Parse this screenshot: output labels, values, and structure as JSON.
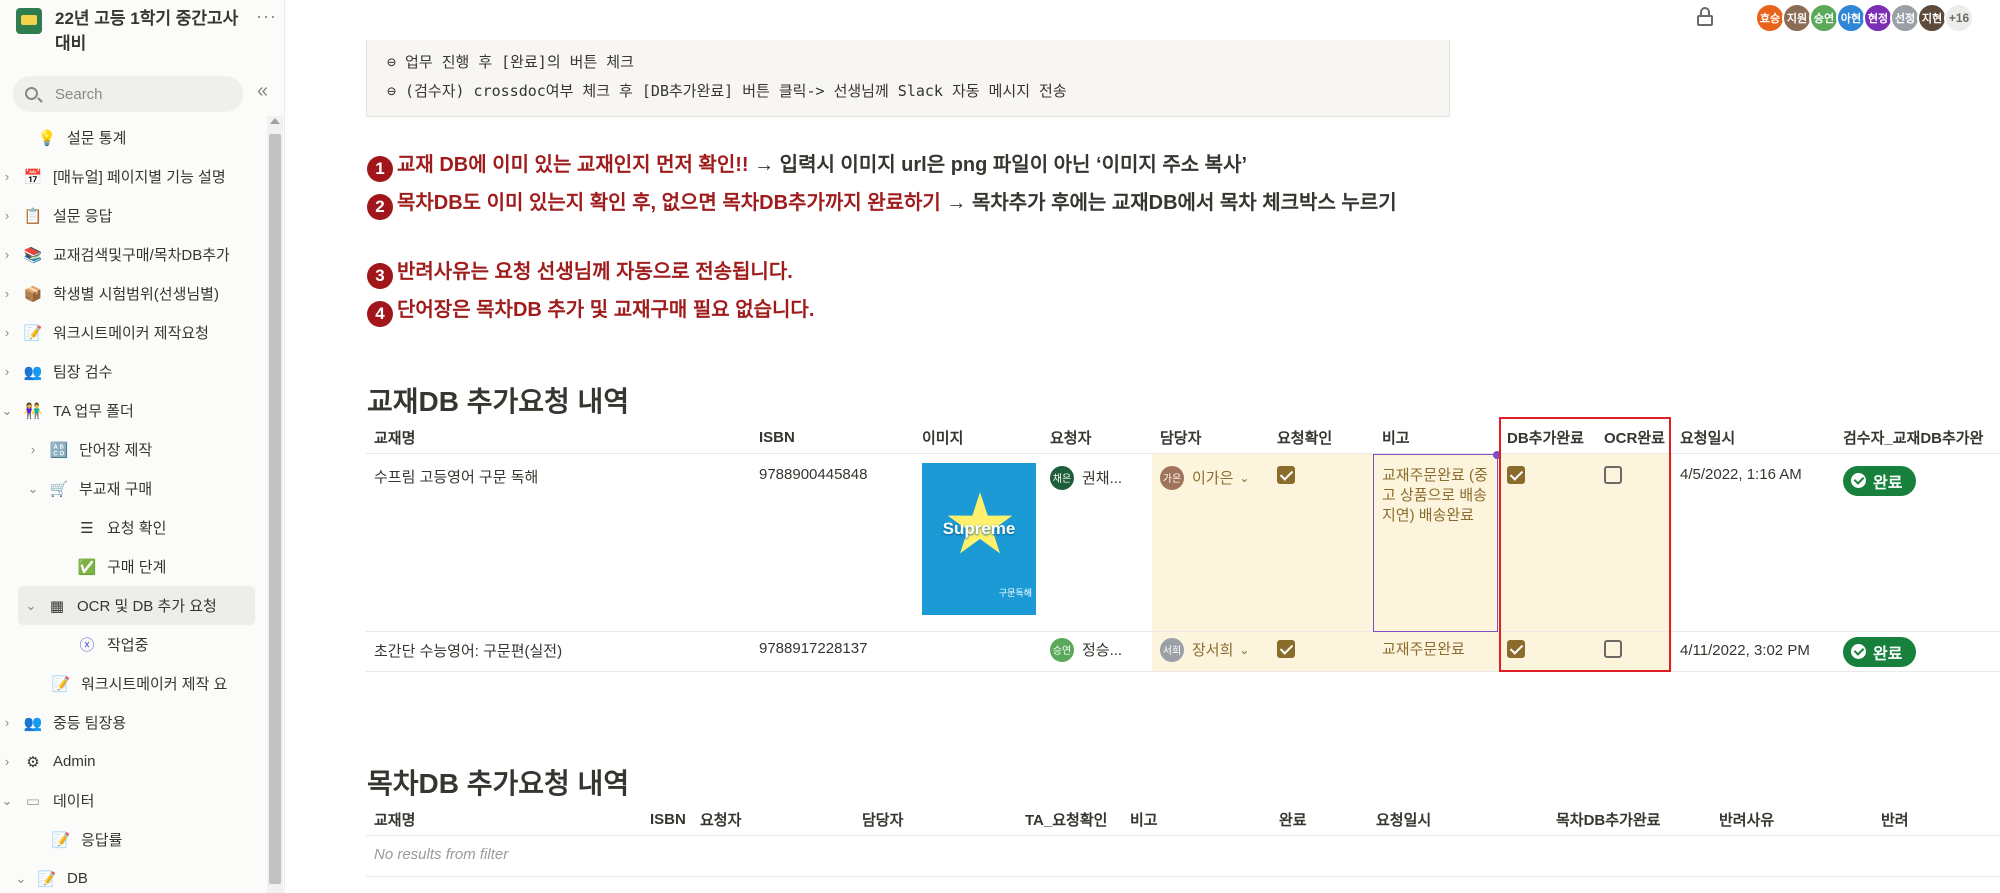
{
  "workspace": {
    "title": "22년 고등 1학기 중간고사 대비",
    "more": "···"
  },
  "search": {
    "placeholder": "Search"
  },
  "sidebar": {
    "collapse": "«",
    "items": [
      {
        "label": "설문 통계",
        "icon": "💡",
        "chev": ""
      },
      {
        "label": "[매뉴얼] 페이지별 기능 설명",
        "icon": "📅",
        "chev": "›"
      },
      {
        "label": "설문 응답",
        "icon": "📋",
        "chev": "›"
      },
      {
        "label": "교재검색및구매/목차DB추가",
        "icon": "📚",
        "chev": "›"
      },
      {
        "label": "학생별 시험범위(선생님별)",
        "icon": "📦",
        "chev": "›"
      },
      {
        "label": "워크시트메이커 제작요청",
        "icon": "📝",
        "chev": "›"
      },
      {
        "label": "팀장 검수",
        "icon": "👥",
        "chev": "›"
      },
      {
        "label": "TA 업무 폴더",
        "icon": "👫",
        "chev": "⌄"
      },
      {
        "label": "단어장 제작",
        "icon": "🔠",
        "chev": "›"
      },
      {
        "label": "부교재 구매",
        "icon": "🛒",
        "chev": "⌄"
      },
      {
        "label": "요청 확인",
        "icon": "☰",
        "chev": ""
      },
      {
        "label": "구매 단계",
        "icon": "✅",
        "chev": ""
      },
      {
        "label": "OCR 및 DB 추가 요청",
        "icon": "▦",
        "chev": "⌄"
      },
      {
        "label": "작업중",
        "icon": "ⓧ",
        "chev": ""
      },
      {
        "label": "워크시트메이커 제작 요",
        "icon": "📝",
        "chev": ""
      },
      {
        "label": "중등 팀장용",
        "icon": "👥",
        "chev": "›"
      },
      {
        "label": "Admin",
        "icon": "⚙",
        "chev": "›"
      },
      {
        "label": "데이터",
        "icon": "▭",
        "chev": "⌄"
      },
      {
        "label": "응답률",
        "icon": "📝",
        "chev": ""
      },
      {
        "label": "DB",
        "icon": "📝",
        "chev": "⌄"
      }
    ]
  },
  "header": {
    "avatars": [
      {
        "label": "효승",
        "color": "#e8631c"
      },
      {
        "label": "지원",
        "color": "#8b6d55"
      },
      {
        "label": "승연",
        "color": "#5aa85a"
      },
      {
        "label": "아현",
        "color": "#2f86d6"
      },
      {
        "label": "현정",
        "color": "#7b2fb5"
      },
      {
        "label": "선정",
        "color": "#9aa0a6"
      },
      {
        "label": "지현",
        "color": "#5d4a3a"
      }
    ],
    "more_count": "+16"
  },
  "code_block": {
    "line1": "⊖ 업무 진행 후 [완료]의 버튼 체크",
    "line2": "⊖ (검수자) crossdoc여부 체크 후 [DB추가완료] 버튼 클릭-> 선생님께 Slack 자동 메시지 전송"
  },
  "callouts": {
    "c1_num": "1",
    "c1_red": "교재 DB에 이미 있는 교재인지 먼저 확인!! ",
    "c1_dark": "→ 입력시 이미지 url은 png 파일이 아닌 ‘이미지 주소 복사’",
    "c2_num": "2",
    "c2_red": "목차DB도 이미 있는지 확인 후, 없으면 목차DB추가까지 완료하기 ",
    "c2_dark": "→ 목차추가 후에는 교재DB에서 목차 체크박스 누르기",
    "c3_num": "3",
    "c3_red": "반려사유는 요청 선생님께 자동으로 전송됩니다.",
    "c4_num": "4",
    "c4_red": "단어장은 목차DB 추가 및 교재구매 필요 없습니다."
  },
  "textbook_db": {
    "title": "교재DB 추가요청 내역",
    "columns": [
      "교재명",
      "ISBN",
      "이미지",
      "요청자",
      "담당자",
      "요청확인",
      "비고",
      "DB추가완료",
      "OCR완료",
      "요청일시",
      "검수자_교재DB추가완"
    ],
    "rows": [
      {
        "name": "수프림 고등영어 구문 독해",
        "isbn": "9788900445848",
        "image_title": "Supreme",
        "image_sub": "구문독해",
        "requester_badge": "채은",
        "requester": "권채...",
        "owner_badge": "가은",
        "owner": "이가은",
        "note": "교재주문완료 (중고 상품으로 배송 지연) 배송완료",
        "date": "4/5/2022, 1:16 AM",
        "status": "완료"
      },
      {
        "name": "초간단 수능영어: 구문편(실전)",
        "isbn": "9788917228137",
        "requester_badge": "승연",
        "requester": "정승...",
        "owner_badge": "서희",
        "owner": "장서희",
        "note": "교재주문완료",
        "date": "4/11/2022, 3:02 PM",
        "status": "완료"
      }
    ]
  },
  "toc_db": {
    "title": "목차DB 추가요청 내역",
    "columns": [
      "교재명",
      "ISBN",
      "요청자",
      "담당자",
      "TA_요청확인",
      "비고",
      "완료",
      "요청일시",
      "목차DB추가완료",
      "반려사유",
      "반려"
    ],
    "empty": "No results from filter"
  }
}
